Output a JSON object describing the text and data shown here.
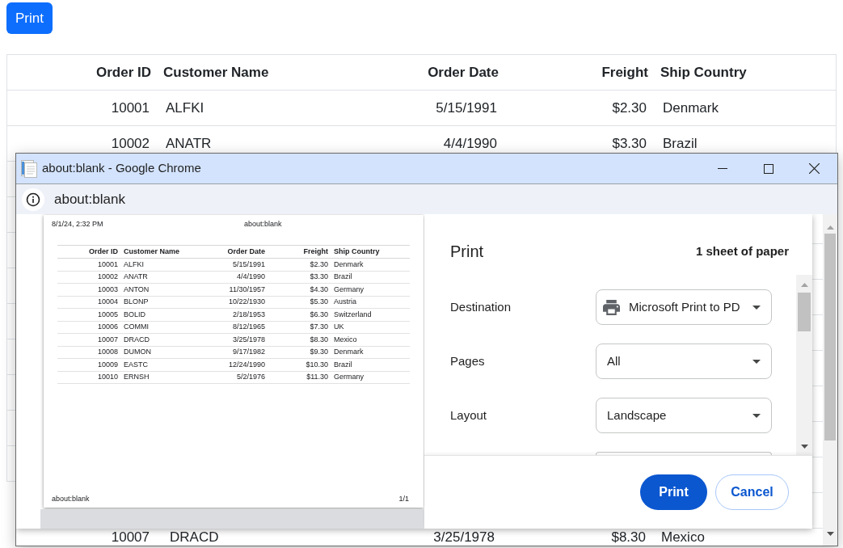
{
  "page": {
    "print_button": {
      "label": "Print"
    },
    "table": {
      "columns": [
        "Order ID",
        "Customer Name",
        "Order Date",
        "Freight",
        "Ship Country"
      ],
      "rows": [
        [
          "10001",
          "ALFKI",
          "5/15/1991",
          "$2.30",
          "Denmark"
        ],
        [
          "10002",
          "ANATR",
          "4/4/1990",
          "$3.30",
          "Brazil"
        ]
      ]
    }
  },
  "browser_window": {
    "title": "about:blank - Google Chrome",
    "address": "about:blank",
    "page_rows": [
      [
        "10007",
        "DRACD",
        "3/25/1978",
        "$8.30",
        "Mexico"
      ]
    ]
  },
  "print_preview": {
    "header_left": "8/1/24, 2:32 PM",
    "header_center": "about:blank",
    "columns": [
      "Order ID",
      "Customer Name",
      "Order Date",
      "Freight",
      "Ship Country"
    ],
    "rows": [
      [
        "10001",
        "ALFKI",
        "5/15/1991",
        "$2.30",
        "Denmark"
      ],
      [
        "10002",
        "ANATR",
        "4/4/1990",
        "$3.30",
        "Brazil"
      ],
      [
        "10003",
        "ANTON",
        "11/30/1957",
        "$4.30",
        "Germany"
      ],
      [
        "10004",
        "BLONP",
        "10/22/1930",
        "$5.30",
        "Austria"
      ],
      [
        "10005",
        "BOLID",
        "2/18/1953",
        "$6.30",
        "Switzerland"
      ],
      [
        "10006",
        "COMMI",
        "8/12/1965",
        "$7.30",
        "UK"
      ],
      [
        "10007",
        "DRACD",
        "3/25/1978",
        "$8.30",
        "Mexico"
      ],
      [
        "10008",
        "DUMON",
        "9/17/1982",
        "$9.30",
        "Denmark"
      ],
      [
        "10009",
        "EASTC",
        "12/24/1990",
        "$10.30",
        "Brazil"
      ],
      [
        "10010",
        "ERNSH",
        "5/2/1976",
        "$11.30",
        "Germany"
      ]
    ],
    "footer_left": "about:blank",
    "footer_right": "1/1"
  },
  "print_dialog": {
    "title": "Print",
    "summary": "1 sheet of paper",
    "settings": [
      {
        "label": "Destination",
        "value": "Microsoft Print to PD",
        "kind": "printer"
      },
      {
        "label": "Pages",
        "value": "All",
        "kind": "plain"
      },
      {
        "label": "Layout",
        "value": "Landscape",
        "kind": "plain"
      }
    ],
    "buttons": [
      {
        "label": "Print",
        "kind": "primary"
      },
      {
        "label": "Cancel",
        "kind": "secondary"
      }
    ]
  }
}
